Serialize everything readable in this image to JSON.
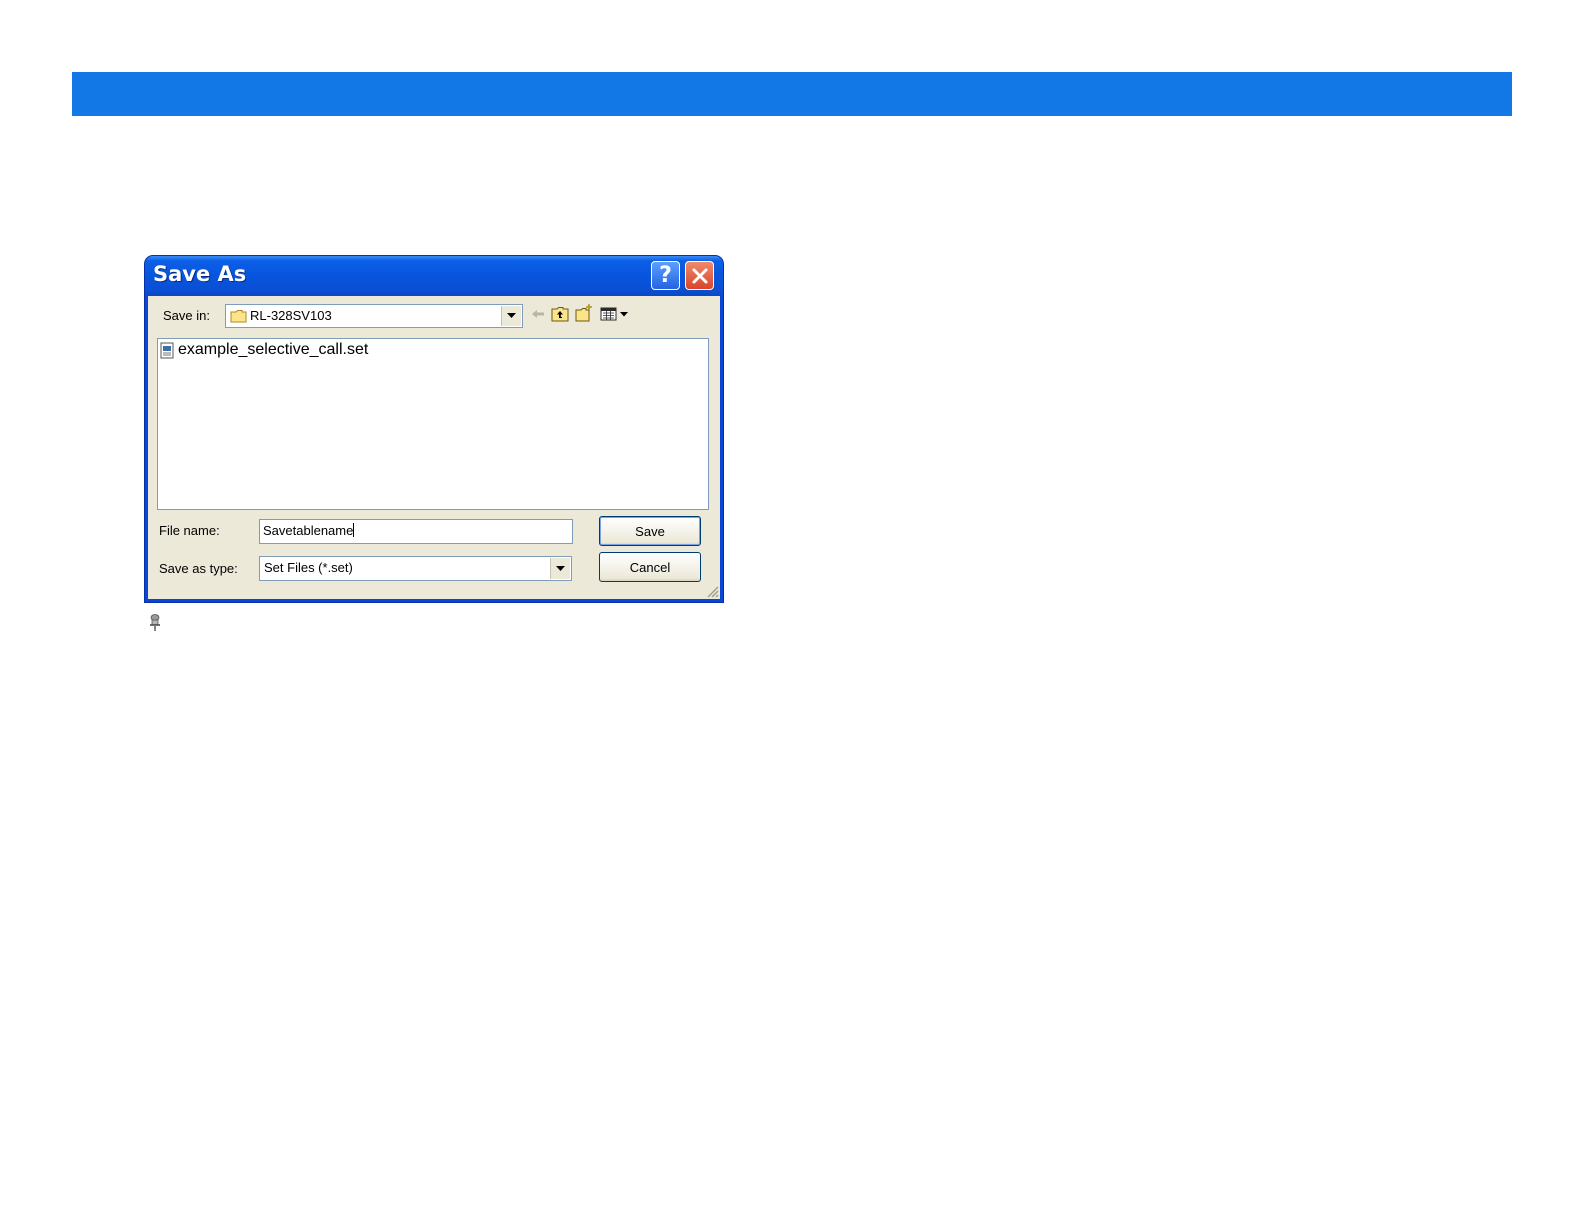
{
  "dialog": {
    "title": "Save As",
    "help_icon": "help-icon",
    "close_icon": "close-icon",
    "save_in_label": "Save in:",
    "save_in_value": "RL-328SV103",
    "toolbar_icons": [
      "back-arrow-icon",
      "up-folder-icon",
      "new-folder-icon",
      "view-menu-icon"
    ],
    "files": [
      {
        "name": "example_selective_call.set",
        "icon": "set-file-icon"
      }
    ],
    "file_name_label": "File name:",
    "file_name_value": "Savetablename",
    "save_as_type_label": "Save as type:",
    "save_as_type_value": "Set Files (*.set)",
    "save_button": "Save",
    "cancel_button": "Cancel"
  },
  "colors": {
    "banner": "#1278e6",
    "titlebar": "#0855dd",
    "dialog_body": "#ece9d8"
  },
  "footnote_icon": "pushpin-icon"
}
